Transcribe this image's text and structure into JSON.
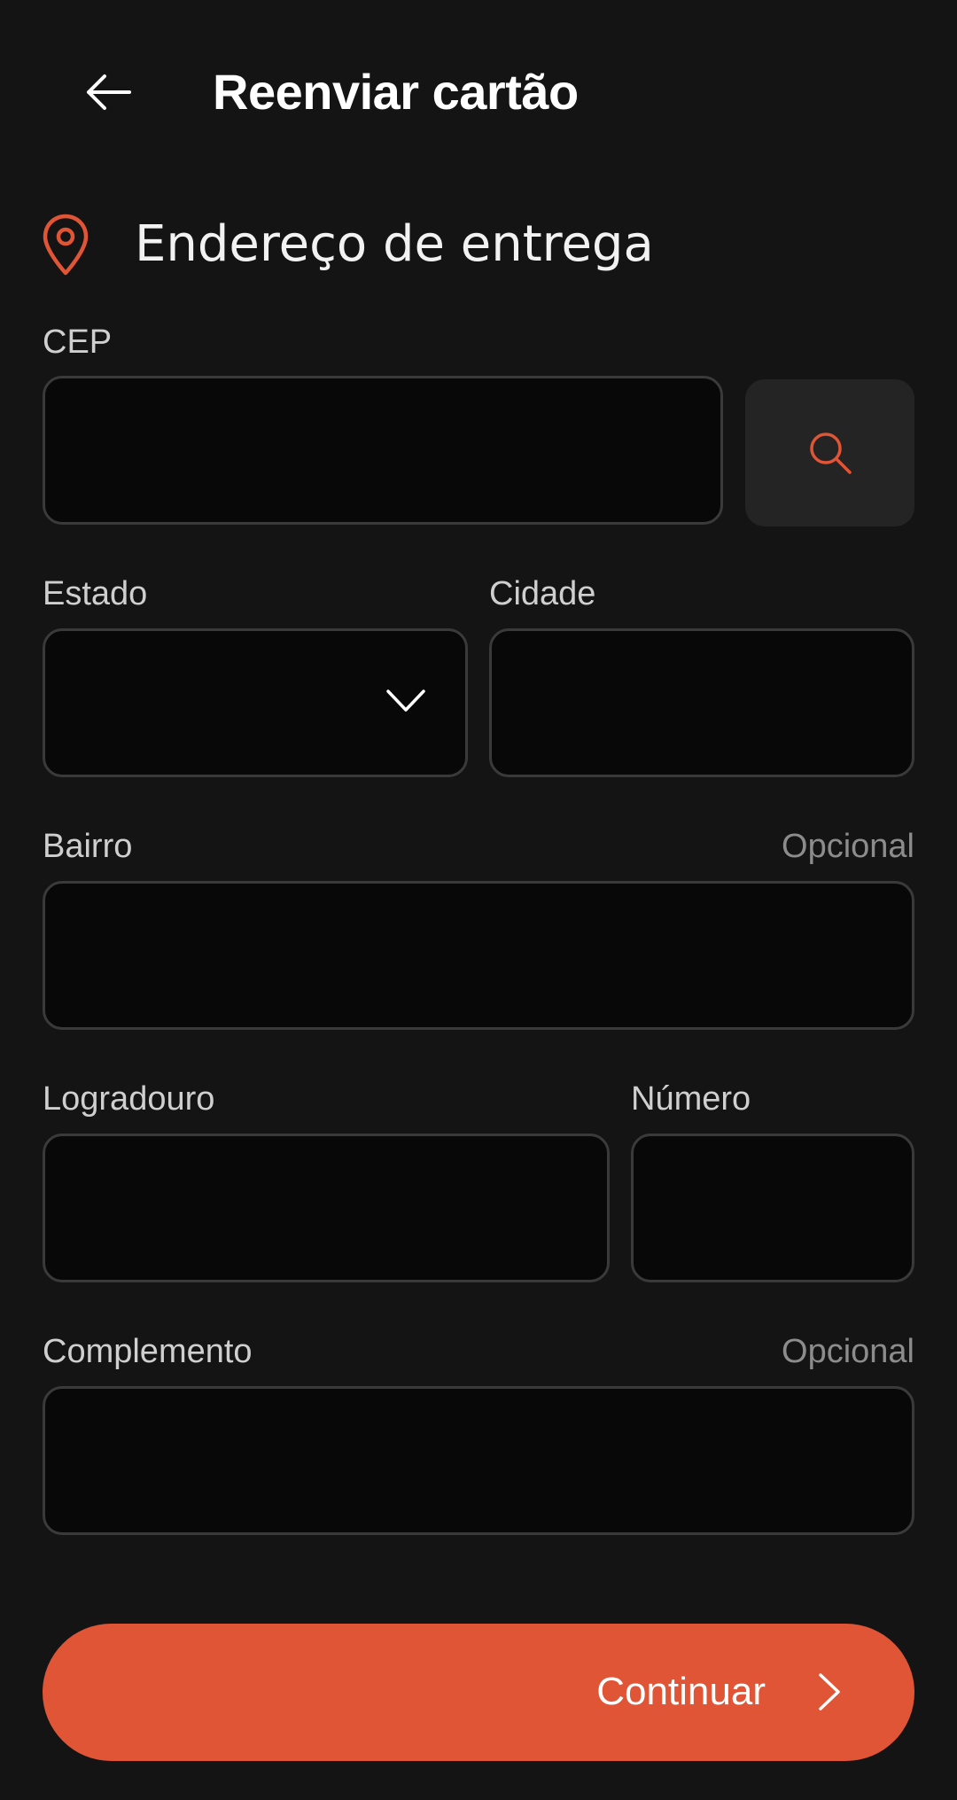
{
  "header": {
    "title": "Reenviar cartão"
  },
  "section": {
    "title": "Endereço de entrega"
  },
  "form": {
    "cep": {
      "label": "CEP",
      "value": ""
    },
    "estado": {
      "label": "Estado",
      "value": ""
    },
    "cidade": {
      "label": "Cidade",
      "value": ""
    },
    "bairro": {
      "label": "Bairro",
      "optional": "Opcional",
      "value": ""
    },
    "logradouro": {
      "label": "Logradouro",
      "value": ""
    },
    "numero": {
      "label": "Número",
      "value": ""
    },
    "complemento": {
      "label": "Complemento",
      "optional": "Opcional",
      "value": ""
    }
  },
  "actions": {
    "continue_label": "Continuar"
  },
  "colors": {
    "background": "#141414",
    "accent": "#e05535",
    "field_bg": "#080808",
    "field_border": "#3a3a3a"
  },
  "icons": {
    "back": "arrow-left-icon",
    "location": "map-pin-icon",
    "search": "search-icon",
    "dropdown": "chevron-down-icon",
    "next": "chevron-right-icon"
  }
}
